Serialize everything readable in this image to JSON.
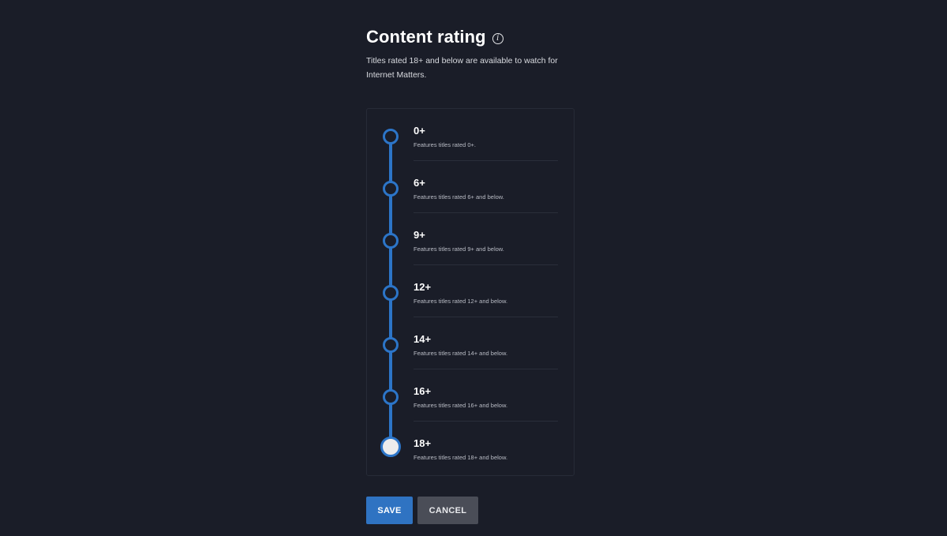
{
  "header": {
    "title": "Content rating",
    "info_icon": "info-icon",
    "subtitle": "Titles rated 18+ and below are available to watch for Internet Matters."
  },
  "ratings": [
    {
      "label": "0+",
      "description": "Features titles rated 0+."
    },
    {
      "label": "6+",
      "description": "Features titles rated 6+ and below."
    },
    {
      "label": "9+",
      "description": "Features titles rated 9+ and below."
    },
    {
      "label": "12+",
      "description": "Features titles rated 12+ and below."
    },
    {
      "label": "14+",
      "description": "Features titles rated 14+ and below."
    },
    {
      "label": "16+",
      "description": "Features titles rated 16+ and below."
    },
    {
      "label": "18+",
      "description": "Features titles rated 18+ and below."
    }
  ],
  "selected_rating": "18+",
  "actions": {
    "save_label": "SAVE",
    "cancel_label": "CANCEL"
  },
  "colors": {
    "background": "#1a1d28",
    "accent": "#2c75c8",
    "cancel_button": "#4a4d57"
  }
}
